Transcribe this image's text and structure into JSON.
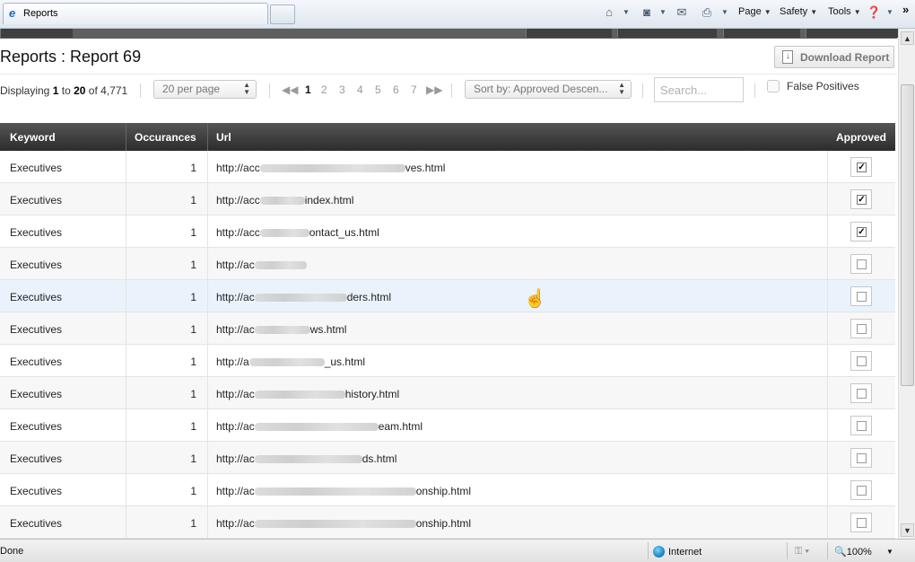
{
  "browser": {
    "tab_title": "Reports",
    "toolbar": {
      "page": "Page",
      "safety": "Safety",
      "tools": "Tools",
      "more": "»"
    }
  },
  "page": {
    "title": "Reports : Report 69",
    "download_label": "Download Report"
  },
  "controls": {
    "display_prefix": "Displaying",
    "display_from": "1",
    "display_to_word": "to",
    "display_to": "20",
    "display_of_word": "of",
    "display_total": "4,771",
    "per_page": "20 per page",
    "pages": [
      "1",
      "2",
      "3",
      "4",
      "5",
      "6",
      "7"
    ],
    "current_page": "1",
    "sort_by": "Sort by: Approved Descen...",
    "search_placeholder": "Search...",
    "false_positives_label": "False Positives"
  },
  "table": {
    "headers": {
      "keyword": "Keyword",
      "occurances": "Occurances",
      "url": "Url",
      "approved": "Approved"
    },
    "rows": [
      {
        "keyword": "Executives",
        "occurances": "1",
        "url_prefix": "http://acc",
        "url_suffix": "ves.html",
        "approved": true
      },
      {
        "keyword": "Executives",
        "occurances": "1",
        "url_prefix": "http://acc",
        "url_suffix": "index.html",
        "approved": true
      },
      {
        "keyword": "Executives",
        "occurances": "1",
        "url_prefix": "http://acc",
        "url_suffix": "ontact_us.html",
        "approved": true
      },
      {
        "keyword": "Executives",
        "occurances": "1",
        "url_prefix": "http://ac",
        "url_suffix": "",
        "approved": false
      },
      {
        "keyword": "Executives",
        "occurances": "1",
        "url_prefix": "http://ac",
        "url_suffix": "ders.html",
        "approved": false
      },
      {
        "keyword": "Executives",
        "occurances": "1",
        "url_prefix": "http://ac",
        "url_suffix": "ws.html",
        "approved": false
      },
      {
        "keyword": "Executives",
        "occurances": "1",
        "url_prefix": "http://a",
        "url_suffix": "_us.html",
        "approved": false
      },
      {
        "keyword": "Executives",
        "occurances": "1",
        "url_prefix": "http://ac",
        "url_suffix": "history.html",
        "approved": false
      },
      {
        "keyword": "Executives",
        "occurances": "1",
        "url_prefix": "http://ac",
        "url_suffix": "eam.html",
        "approved": false
      },
      {
        "keyword": "Executives",
        "occurances": "1",
        "url_prefix": "http://ac",
        "url_suffix": "ds.html",
        "approved": false
      },
      {
        "keyword": "Executives",
        "occurances": "1",
        "url_prefix": "http://ac",
        "url_suffix": "onship.html",
        "approved": false
      },
      {
        "keyword": "Executives",
        "occurances": "1",
        "url_prefix": "http://ac",
        "url_suffix": "onship.html",
        "approved": false
      }
    ]
  },
  "status": {
    "left": "Done",
    "zone": "Internet",
    "zoom": "100%"
  }
}
